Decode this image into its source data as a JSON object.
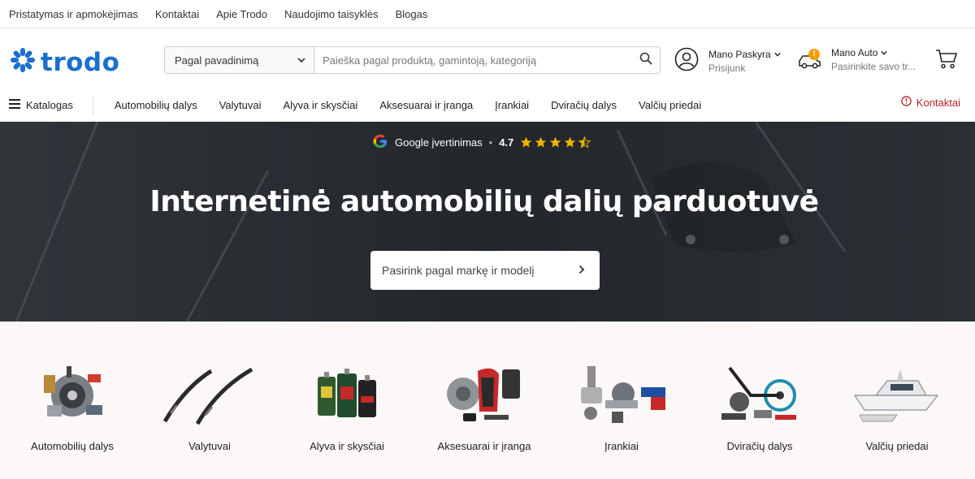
{
  "topbar": {
    "links": [
      "Pristatymas ir apmokėjimas",
      "Kontaktai",
      "Apie Trodo",
      "Naudojimo taisyklės",
      "Blogas"
    ]
  },
  "header": {
    "logo": "trodo",
    "search": {
      "select_value": "Pagal pavadinimą",
      "placeholder": "Paieška pagal produktą, gamintoją, kategoriją"
    },
    "account": {
      "title": "Mano Paskyra",
      "subtitle": "Prisijunk"
    },
    "car": {
      "title": "Mano Auto",
      "subtitle": "Pasirinkite savo tr...",
      "badge": "!"
    }
  },
  "nav": {
    "catalog_label": "Katalogas",
    "items": [
      "Automobilių dalys",
      "Valytuvai",
      "Alyva ir skysčiai",
      "Aksesuarai ir įranga",
      "Įrankiai",
      "Dviračių dalys",
      "Valčių priedai"
    ],
    "contact_label": "Kontaktai"
  },
  "hero": {
    "rating_label": "Google įvertinimas",
    "rating_score": "4.7",
    "rating_stars": 4.5,
    "title": "Internetinė automobilių dalių parduotuvė",
    "button_label": "Pasirink pagal markę ir modelį"
  },
  "categories": [
    "Automobilių dalys",
    "Valytuvai",
    "Alyva ir skysčiai",
    "Aksesuarai ir įranga",
    "Įrankiai",
    "Dviračių dalys",
    "Valčių priedai"
  ],
  "colors": {
    "brand": "#1a6fcf",
    "accent_red": "#b3261e",
    "star": "#f5b301",
    "hero_bg": "#2b3036",
    "badge": "#f59e0b"
  }
}
